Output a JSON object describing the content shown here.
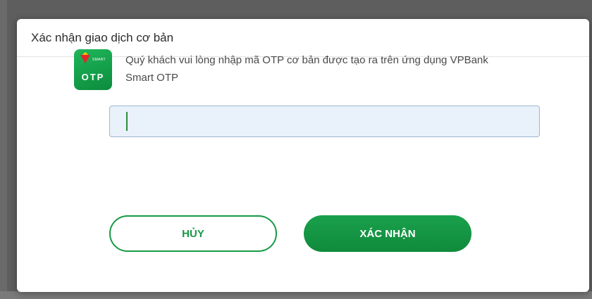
{
  "dialog": {
    "title": "Xác nhận giao dịch cơ bản",
    "message": "Quý khách vui lòng nhập mã OTP cơ bản được tạo ra trên ứng dụng VPBank Smart OTP",
    "app_icon": {
      "name": "vpbank-smart-otp-icon",
      "smart_label": "SMART",
      "otp_label": "OTP"
    },
    "otp_input": {
      "value": "",
      "placeholder": ""
    },
    "buttons": {
      "cancel_label": "HỦY",
      "confirm_label": "XÁC NHẬN"
    }
  },
  "colors": {
    "brand_green": "#179a45",
    "input_bg": "#e9f1fb",
    "input_border": "#9fb6cf"
  }
}
